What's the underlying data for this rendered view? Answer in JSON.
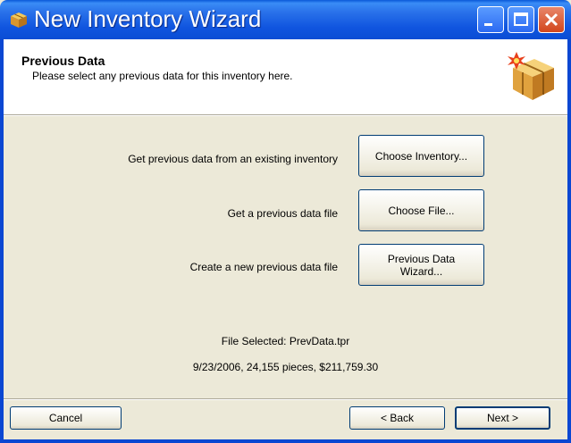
{
  "window": {
    "title": "New Inventory Wizard",
    "controls": {
      "minimize": "minimize",
      "maximize": "maximize",
      "close": "close"
    }
  },
  "header": {
    "title": "Previous Data",
    "subtitle": "Please select any previous data for this inventory here.",
    "icon": "package-icon"
  },
  "options": [
    {
      "label": "Get previous data from an existing inventory",
      "button": "Choose Inventory..."
    },
    {
      "label": "Get a previous data file",
      "button": "Choose File..."
    },
    {
      "label": "Create a new previous data file",
      "button_line1": "Previous Data",
      "button_line2": "Wizard..."
    }
  ],
  "selection": {
    "file_selected": "File Selected: PrevData.tpr",
    "summary": "9/23/2006, 24,155 pieces, $211,759.30"
  },
  "footer": {
    "cancel": "Cancel",
    "back": "< Back",
    "next": "Next >"
  },
  "colors": {
    "titlebar": "#0a4dd4",
    "face": "#ece9d8",
    "close": "#d2461c"
  }
}
